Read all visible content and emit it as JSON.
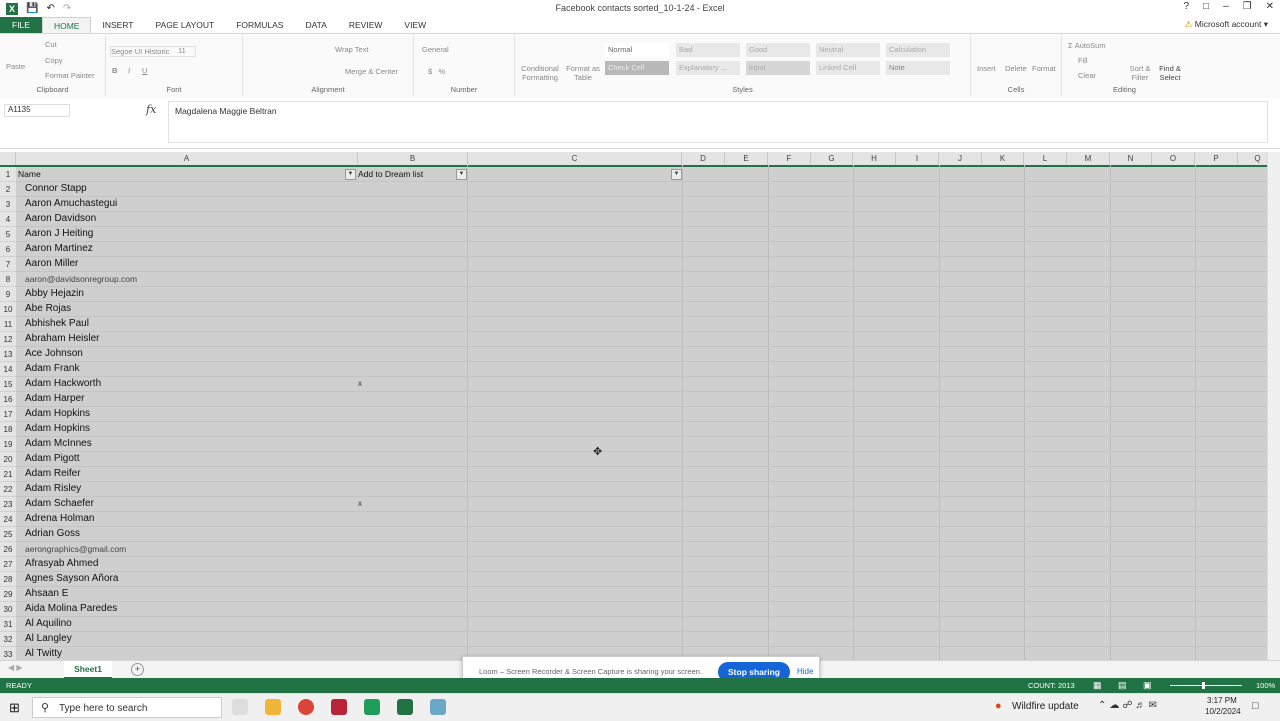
{
  "window": {
    "title": "Facebook contacts sorted_10-1-24 - Excel",
    "account": "Microsoft account"
  },
  "ribbon_tabs": [
    "FILE",
    "HOME",
    "INSERT",
    "PAGE LAYOUT",
    "FORMULAS",
    "DATA",
    "REVIEW",
    "VIEW"
  ],
  "ribbon": {
    "clipboard": {
      "label": "Clipboard",
      "cut": "Cut",
      "copy": "Copy",
      "format_painter": "Format Painter",
      "paste": "Paste"
    },
    "font": {
      "label": "Font",
      "name": "Segoe UI Historic",
      "size": "11"
    },
    "alignment": {
      "label": "Alignment",
      "wrap": "Wrap Text",
      "merge": "Merge & Center"
    },
    "number": {
      "label": "Number",
      "format": "General"
    },
    "styles": {
      "label": "Styles",
      "conditional": "Conditional Formatting",
      "format_table": "Format as Table",
      "items": [
        "Normal",
        "Bad",
        "Good",
        "Neutral",
        "Calculation",
        "Check Cell",
        "Explanatory ...",
        "Input",
        "Linked Cell",
        "Note"
      ]
    },
    "cells": {
      "label": "Cells",
      "insert": "Insert",
      "delete": "Delete",
      "format": "Format"
    },
    "editing": {
      "label": "Editing",
      "autosum": "AutoSum",
      "fill": "Fill",
      "clear": "Clear",
      "sort": "Sort & Filter",
      "find": "Find & Select"
    }
  },
  "formula_bar": {
    "name_box": "A1135",
    "fx": "fx",
    "content": "Magdalena Maggie Beltran"
  },
  "columns": [
    "A",
    "B",
    "C",
    "D",
    "E",
    "F",
    "G",
    "H",
    "I",
    "J",
    "K",
    "L",
    "M",
    "N",
    "O",
    "P",
    "Q"
  ],
  "header_row": {
    "num": "1",
    "a": "Name",
    "b": "Add to Dream list"
  },
  "rows": [
    {
      "num": "2",
      "a": "Connor Stapp",
      "b": ""
    },
    {
      "num": "3",
      "a": "Aaron Amuchastegui",
      "b": ""
    },
    {
      "num": "4",
      "a": "Aaron Davidson",
      "b": ""
    },
    {
      "num": "5",
      "a": "Aaron J Heiting",
      "b": ""
    },
    {
      "num": "6",
      "a": "Aaron Martinez",
      "b": ""
    },
    {
      "num": "7",
      "a": "Aaron Miller",
      "b": ""
    },
    {
      "num": "8",
      "a": "aaron@davidsonregroup.com",
      "b": ""
    },
    {
      "num": "9",
      "a": "Abby Hejazin",
      "b": ""
    },
    {
      "num": "10",
      "a": "Abe Rojas",
      "b": ""
    },
    {
      "num": "11",
      "a": "Abhishek Paul",
      "b": ""
    },
    {
      "num": "12",
      "a": "Abraham Heisler",
      "b": ""
    },
    {
      "num": "13",
      "a": "Ace Johnson",
      "b": ""
    },
    {
      "num": "14",
      "a": "Adam Frank",
      "b": ""
    },
    {
      "num": "15",
      "a": "Adam Hackworth",
      "b": "x"
    },
    {
      "num": "16",
      "a": "Adam Harper",
      "b": ""
    },
    {
      "num": "17",
      "a": "Adam Hopkins",
      "b": ""
    },
    {
      "num": "18",
      "a": "Adam Hopkins",
      "b": ""
    },
    {
      "num": "19",
      "a": "Adam McInnes",
      "b": ""
    },
    {
      "num": "20",
      "a": "Adam Pigott",
      "b": ""
    },
    {
      "num": "21",
      "a": "Adam Reifer",
      "b": ""
    },
    {
      "num": "22",
      "a": "Adam Risley",
      "b": ""
    },
    {
      "num": "23",
      "a": "Adam Schaefer",
      "b": "x"
    },
    {
      "num": "24",
      "a": "Adrena Holman",
      "b": ""
    },
    {
      "num": "25",
      "a": "Adrian Goss",
      "b": ""
    },
    {
      "num": "26",
      "a": "aerongraphics@gmail.com",
      "b": ""
    },
    {
      "num": "27",
      "a": "Afrasyab Ahmed",
      "b": ""
    },
    {
      "num": "28",
      "a": "Agnes Sayson Añora",
      "b": ""
    },
    {
      "num": "29",
      "a": "Ahsaan E",
      "b": ""
    },
    {
      "num": "30",
      "a": "Aida Molina Paredes",
      "b": ""
    },
    {
      "num": "31",
      "a": "Al Aquilino",
      "b": ""
    },
    {
      "num": "32",
      "a": "Al Langley",
      "b": ""
    },
    {
      "num": "33",
      "a": "Al Twitty",
      "b": ""
    }
  ],
  "sheet": {
    "tab": "Sheet1"
  },
  "loom": {
    "message": "Loom – Screen Recorder & Screen Capture is sharing your screen.",
    "stop": "Stop sharing",
    "hide": "Hide"
  },
  "status": {
    "mode": "READY",
    "count": "COUNT: 2013",
    "zoom": "100%"
  },
  "taskbar": {
    "search_placeholder": "Type here to search",
    "weather": "Wildfire update",
    "time": "3:17 PM",
    "date": "10/2/2024"
  }
}
